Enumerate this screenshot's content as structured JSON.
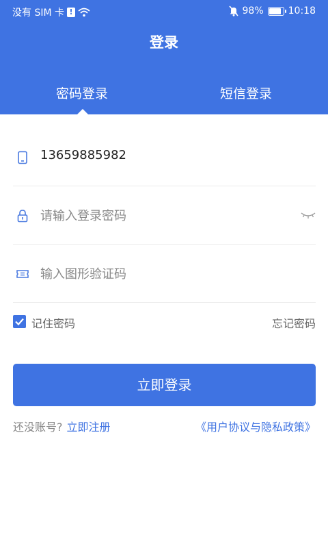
{
  "status_bar": {
    "carrier": "没有 SIM 卡",
    "sim_warning": "!",
    "battery": "98%",
    "battery_level": 0.98,
    "time": "10:18"
  },
  "header": {
    "title": "登录",
    "tabs": [
      {
        "label": "密码登录",
        "active": true
      },
      {
        "label": "短信登录",
        "active": false
      }
    ]
  },
  "form": {
    "phone": {
      "value": "13659885982"
    },
    "password": {
      "placeholder": "请输入登录密码"
    },
    "captcha": {
      "placeholder": "输入图形验证码"
    }
  },
  "options": {
    "remember_label": "记住密码",
    "remember_checked": true,
    "forgot_label": "忘记密码"
  },
  "login_button": "立即登录",
  "footer": {
    "no_account": "还没账号?",
    "register": "立即注册",
    "policy": "《用户协议与隐私政策》"
  },
  "colors": {
    "primary": "#3f73e2",
    "text": "#222222",
    "placeholder": "#8a8a8a"
  }
}
